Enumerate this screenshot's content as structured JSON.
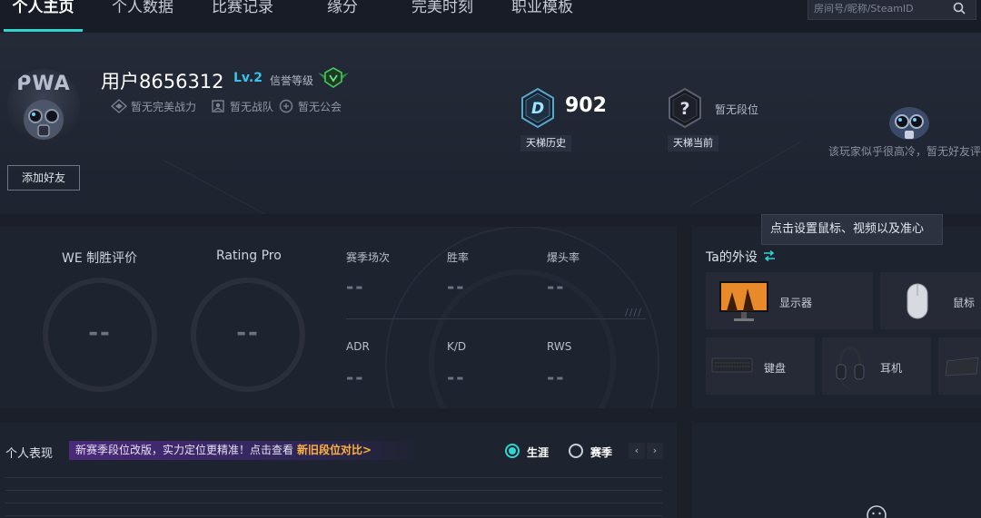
{
  "nav": {
    "tabs": [
      {
        "label": "个人主页",
        "active": true
      },
      {
        "label": "个人数据"
      },
      {
        "label": "比赛记录"
      },
      {
        "label": "缘分"
      },
      {
        "label": "完美时刻"
      },
      {
        "label": "职业模板"
      }
    ],
    "search_placeholder": "房间号/昵称/SteamID",
    "search_icon": "search-icon"
  },
  "profile": {
    "avatar_text": "PWA",
    "username": "用户8656312",
    "level": "Lv.2",
    "credit_label": "信誉等级",
    "badges": [
      "暂无完美战力",
      "暂无战队",
      "暂无公会"
    ],
    "add_friend_label": "添加好友",
    "friend_message": "该玩家似乎很高冷，暂无好友评"
  },
  "ranks": {
    "history": {
      "letter": "D",
      "score": "902",
      "label": "天梯历史"
    },
    "current": {
      "symbol": "?",
      "status": "暂无段位",
      "label": "天梯当前"
    }
  },
  "tooltip": "点击设置鼠标、视频以及准心",
  "stats": {
    "we_title": "WE 制胜评价",
    "we_value": "--",
    "rating_title": "Rating Pro",
    "rating_value": "--",
    "metrics": [
      {
        "label": "赛季场次",
        "value": "--"
      },
      {
        "label": "胜率",
        "value": "--"
      },
      {
        "label": "爆头率",
        "value": "--"
      },
      {
        "label": "ADR",
        "value": "--"
      },
      {
        "label": "K/D",
        "value": "--"
      },
      {
        "label": "RWS",
        "value": "--"
      }
    ],
    "slashes": "////"
  },
  "gear": {
    "title": "Ta的外设",
    "items": [
      "显示器",
      "鼠标",
      "键盘",
      "耳机"
    ]
  },
  "performance": {
    "title": "个人表现",
    "promo_text": "新赛季段位改版，实力定位更精准！点击查看",
    "promo_link": "新旧段位对比>",
    "modes": [
      {
        "label": "生涯",
        "selected": true
      },
      {
        "label": "赛季",
        "selected": false
      }
    ],
    "prev": "‹",
    "next": "›"
  },
  "colors": {
    "accent": "#2fd6d0",
    "level": "#37c3e8",
    "promo_link": "#ffb23e",
    "background": "#1b1f2a",
    "panel": "#1e2330"
  }
}
